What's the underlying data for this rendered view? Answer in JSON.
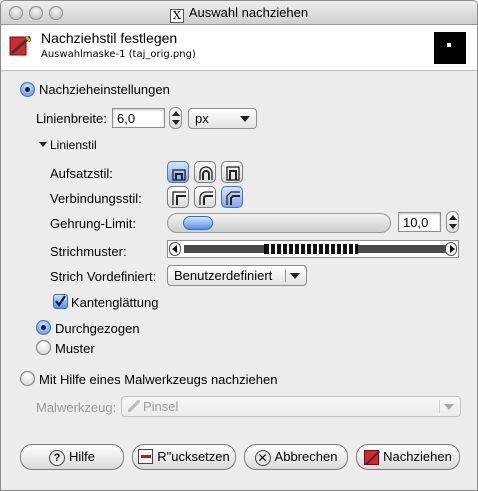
{
  "window": {
    "title": "Auswahl nachziehen"
  },
  "header": {
    "title": "Nachziehstil festlegen",
    "subtitle": "Auswahlmaske-1 (taj_orig.png)"
  },
  "stroke_line": {
    "label": "Nachzieheinstellungen",
    "selected": true,
    "line_width_label": "Linienbreite:",
    "line_width_value": "6,0",
    "unit": "px",
    "line_style_expander": "Linienstil",
    "cap_style_label": "Aufsatzstil:",
    "join_style_label": "Verbindungsstil:",
    "miter_limit_label": "Gehrung-Limit:",
    "miter_limit_value": "10,0",
    "miter_limit_fraction": 0.07,
    "dash_pattern_label": "Strichmuster:",
    "dash_preset_label": "Strich Vordefiniert:",
    "dash_preset_value": "Benutzerdefiniert",
    "antialias_label": "Kantenglättung",
    "antialias_checked": true,
    "solid_label": "Durchgezogen",
    "pattern_label": "Muster",
    "fill_mode": "solid",
    "cap_selected": 0,
    "join_selected": 2
  },
  "stroke_paint": {
    "label": "Mit Hilfe eines Malwerkzeugs nachziehen",
    "selected": false,
    "tool_label": "Malwerkzeug:",
    "tool_value": "Pinsel"
  },
  "buttons": {
    "help": "Hilfe",
    "reset": "R\"ucksetzen",
    "cancel": "Abbrechen",
    "stroke": "Nachziehen"
  }
}
